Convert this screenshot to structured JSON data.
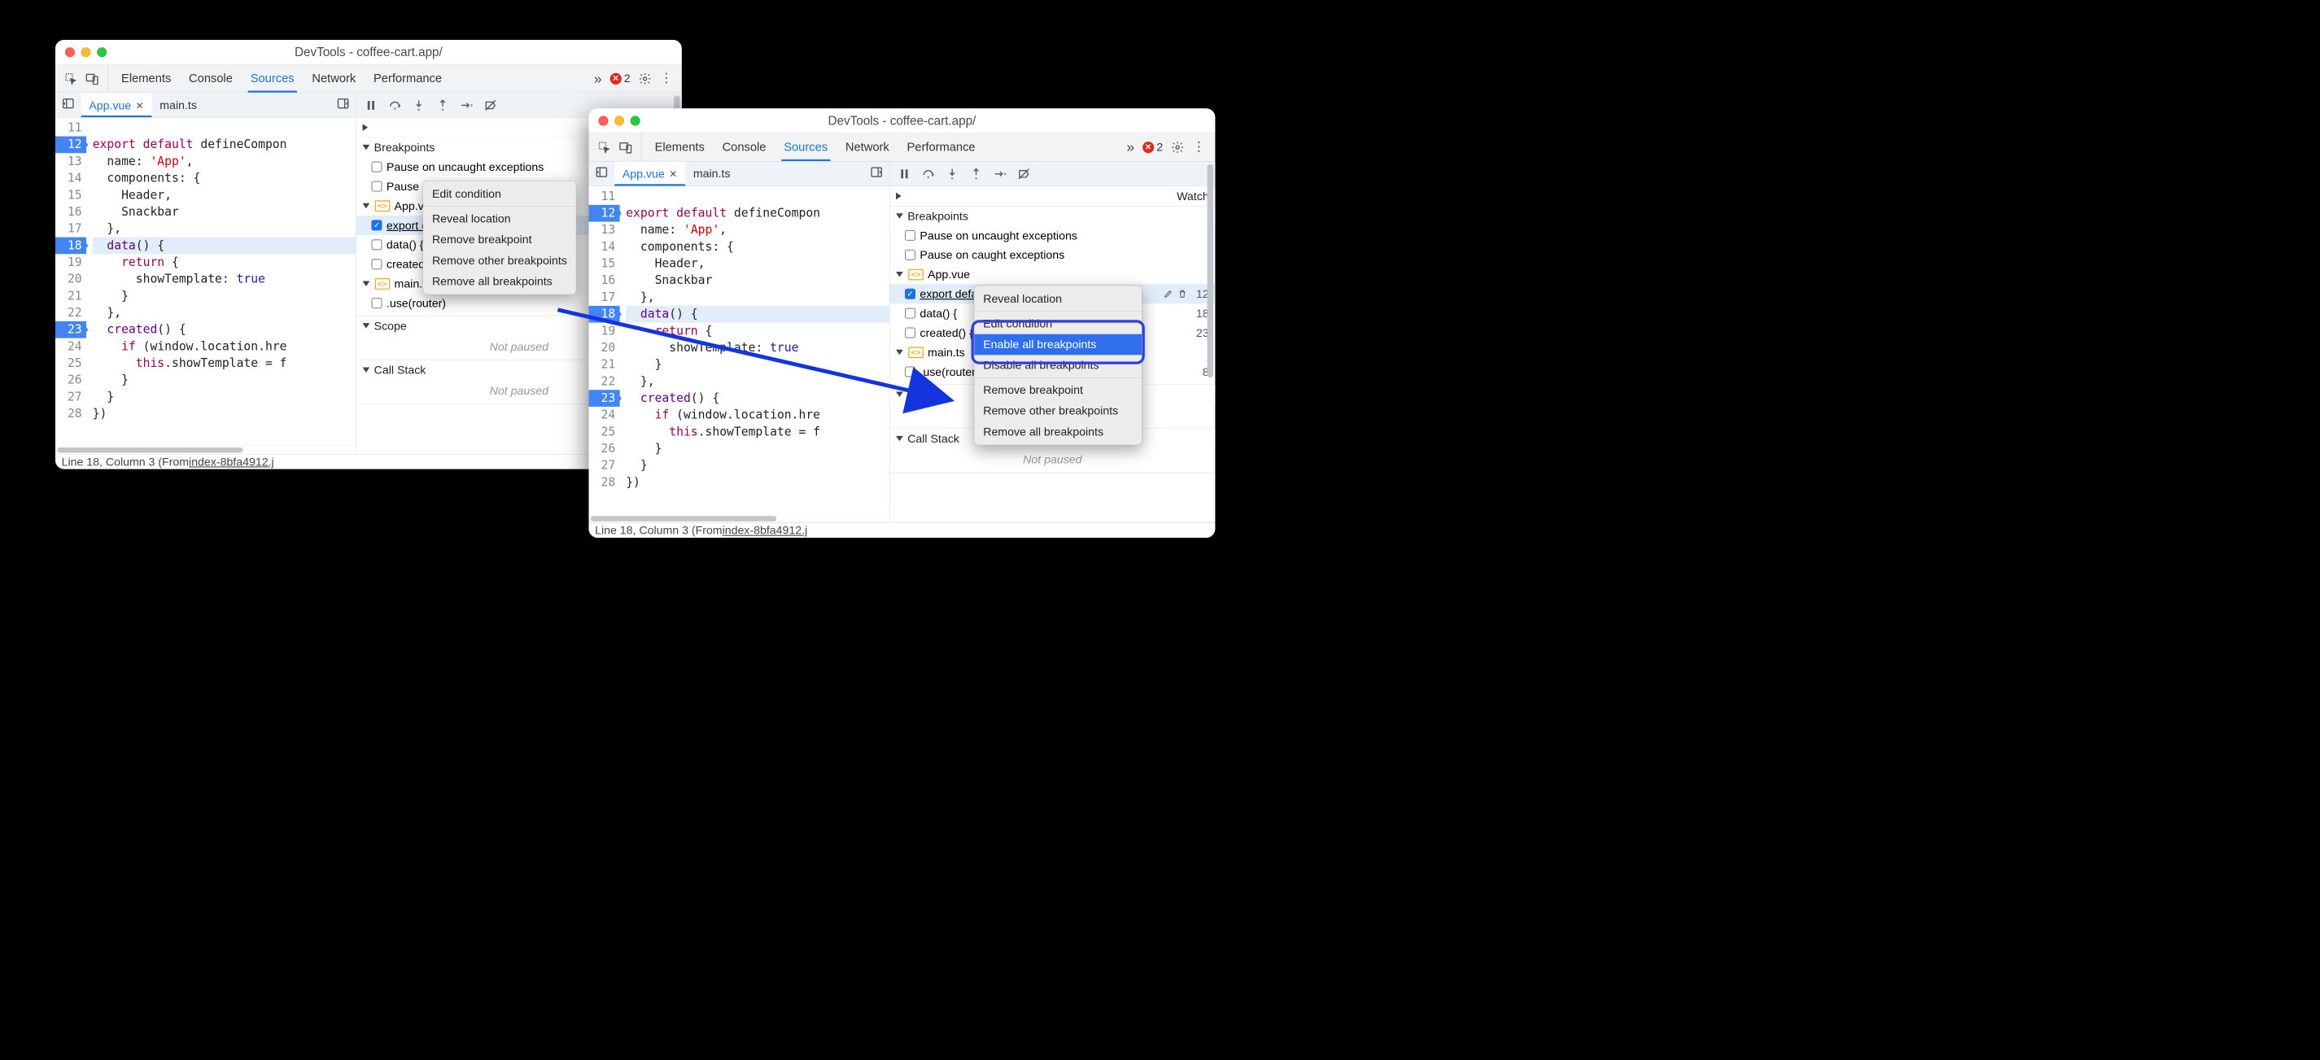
{
  "windowTitle": "DevTools - coffee-cart.app/",
  "toolbar": {
    "tabs": [
      "Elements",
      "Console",
      "Sources",
      "Network",
      "Performance"
    ],
    "activeTab": "Sources",
    "overflow": "»",
    "errCount": "2"
  },
  "fileTabs": {
    "active": "App.vue",
    "inactive": "main.ts"
  },
  "gutterStart": 11,
  "code": {
    "lines": [
      {
        "n": 11,
        "bp": false,
        "hl": false,
        "html": ""
      },
      {
        "n": 12,
        "bp": true,
        "hl": false,
        "seg": [
          "kw:export",
          "sp",
          " ",
          "kw:default",
          "sp",
          " ",
          "fn:defineCompon"
        ]
      },
      {
        "n": 13,
        "bp": false,
        "hl": false,
        "seg": [
          "  ",
          "fn:name",
          ": ",
          "str:'App'",
          ","
        ]
      },
      {
        "n": 14,
        "bp": false,
        "hl": false,
        "seg": [
          "  ",
          "fn:components",
          ": {"
        ]
      },
      {
        "n": 15,
        "bp": false,
        "hl": false,
        "seg": [
          "    ",
          "fn:Header",
          ","
        ]
      },
      {
        "n": 16,
        "bp": false,
        "hl": false,
        "seg": [
          "    ",
          "fn:Snackbar"
        ]
      },
      {
        "n": 17,
        "bp": false,
        "hl": false,
        "seg": [
          "  },"
        ]
      },
      {
        "n": 18,
        "bp": true,
        "hl": true,
        "seg": [
          "  ",
          "prop:data",
          "() {"
        ]
      },
      {
        "n": 19,
        "bp": false,
        "hl": false,
        "seg": [
          "    ",
          "kw:return",
          " {"
        ]
      },
      {
        "n": 20,
        "bp": false,
        "hl": false,
        "seg": [
          "      ",
          "fn:showTemplate",
          ": ",
          "bool:true"
        ]
      },
      {
        "n": 21,
        "bp": false,
        "hl": false,
        "seg": [
          "    }"
        ]
      },
      {
        "n": 22,
        "bp": false,
        "hl": false,
        "seg": [
          "  },"
        ]
      },
      {
        "n": 23,
        "bp": true,
        "hl": false,
        "seg": [
          "  ",
          "prop:created",
          "() {"
        ]
      },
      {
        "n": 24,
        "bp": false,
        "hl": false,
        "seg": [
          "    ",
          "kw:if",
          " (",
          "fn:window",
          ".",
          "fn:location",
          ".",
          "fn:hre"
        ]
      },
      {
        "n": 25,
        "bp": false,
        "hl": false,
        "seg": [
          "      ",
          "kw:this",
          ".",
          "fn:showTemplate",
          " = ",
          "fn:f"
        ]
      },
      {
        "n": 26,
        "bp": false,
        "hl": false,
        "seg": [
          "    }"
        ]
      },
      {
        "n": 27,
        "bp": false,
        "hl": false,
        "seg": [
          "  }"
        ]
      },
      {
        "n": 28,
        "bp": false,
        "hl": false,
        "seg": [
          "})"
        ]
      }
    ]
  },
  "status": {
    "pre": "Line 18, Column 3  (From ",
    "link": "index-8bfa4912.j"
  },
  "rightPane": {
    "watch": "Watch",
    "breakpoints": "Breakpoints",
    "pauseUncaught": "Pause on uncaught exceptions",
    "pauseCaught": "Pause on caught exceptions",
    "file1": "App.vue",
    "file2": "main.ts",
    "bp1": {
      "items": [
        {
          "label": "export default defineComponen",
          "chk": true,
          "sel": true,
          "ln": "12"
        },
        {
          "label": "data() {",
          "chk": false,
          "sel": false,
          "ln": "18"
        },
        {
          "label": "created() {",
          "chk": false,
          "sel": false,
          "ln": "23"
        }
      ]
    },
    "bp2": {
      "items": [
        {
          "label": ".use(router)",
          "chk": false,
          "ln": "8"
        }
      ]
    },
    "scope": "Scope",
    "callstack": "Call Stack",
    "notPaused": "Not paused"
  },
  "ctx1": {
    "items": [
      "Edit condition",
      "Reveal location",
      "Remove breakpoint",
      "Remove other breakpoints",
      "Remove all breakpoints"
    ],
    "sep": [
      1
    ]
  },
  "ctx2": {
    "items": [
      "Reveal location",
      "Edit condition",
      "Enable all breakpoints",
      "Disable all breakpoints",
      "Remove breakpoint",
      "Remove other breakpoints",
      "Remove all breakpoints"
    ],
    "sep": [
      1,
      3
    ]
  }
}
